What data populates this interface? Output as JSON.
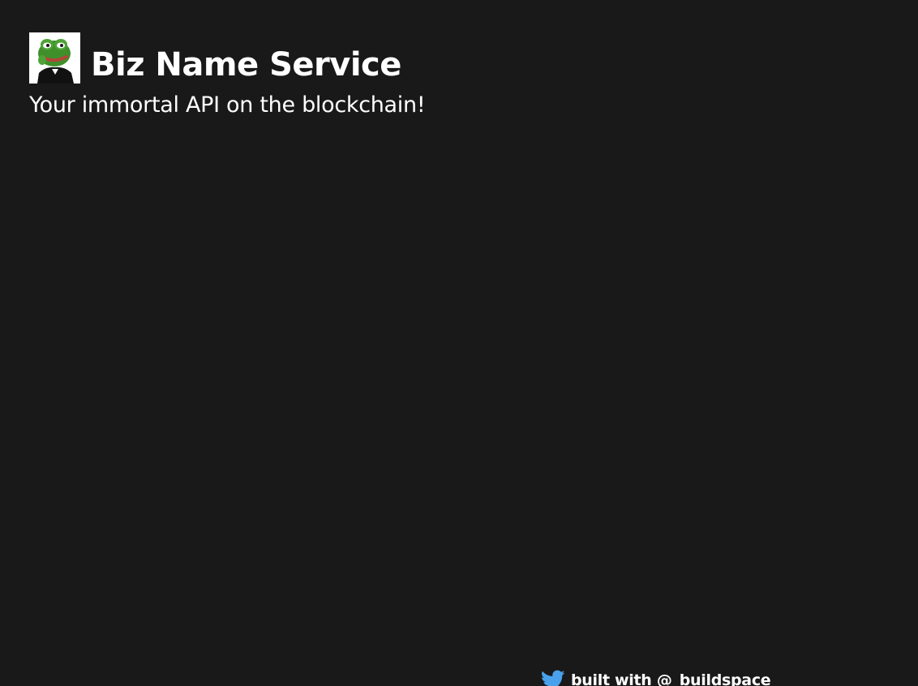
{
  "header": {
    "logo_icon": "frog-avatar-icon",
    "title": "Biz Name Service",
    "subtitle": "Your immortal API on the blockchain!"
  },
  "footer": {
    "icon": "twitter-icon",
    "icon_color": "#4aa1eb",
    "link_text": "built with @_buildspace"
  },
  "colors": {
    "background": "#191919",
    "text": "#ffffff"
  }
}
